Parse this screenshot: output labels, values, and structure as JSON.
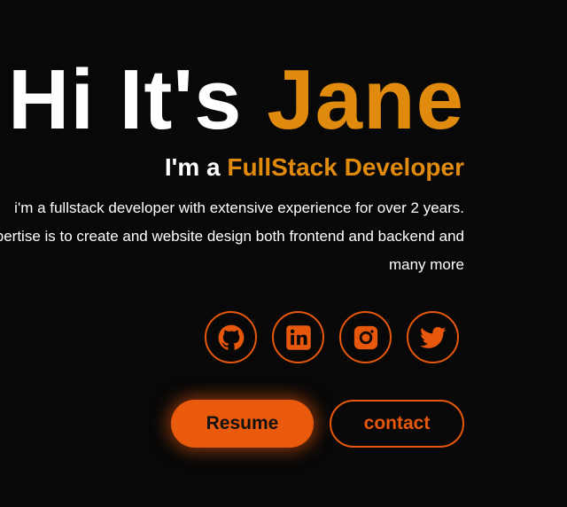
{
  "hero": {
    "greeting": "Hi It's",
    "name": "Jane",
    "role_prefix": "I'm a",
    "role": "FullStack Developer",
    "description": "i'm a fullstack developer with extensive experience for over 2 years. Expertise is to create and website design both frontend and backend and many more"
  },
  "socials": [
    {
      "icon": "github-icon"
    },
    {
      "icon": "linkedin-icon"
    },
    {
      "icon": "instagram-icon"
    },
    {
      "icon": "twitter-icon"
    }
  ],
  "buttons": {
    "resume": "Resume",
    "contact": "contact"
  },
  "colors": {
    "background": "#080808",
    "accent_name": "#e08a0e",
    "accent_buttons": "#e8580c",
    "text": "#ffffff"
  }
}
